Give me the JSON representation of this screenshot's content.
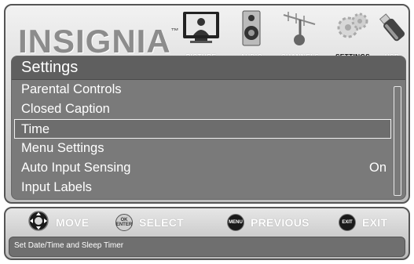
{
  "brand": {
    "logo_text": "INSIGNIA",
    "trademark": "™"
  },
  "tabs": [
    {
      "label": "PICTURE",
      "icon": "tv-icon",
      "active": false
    },
    {
      "label": "AUDIO",
      "icon": "speaker-icon",
      "active": false
    },
    {
      "label": "CHANNELS",
      "icon": "antenna-icon",
      "active": false
    },
    {
      "label": "SETTINGS",
      "icon": "gears-icon",
      "active": true
    },
    {
      "label": "USB",
      "icon": "usb-stick-icon",
      "active": false
    }
  ],
  "menu": {
    "title": "Settings",
    "items": [
      {
        "label": "Parental Controls",
        "value": ""
      },
      {
        "label": "Closed Caption",
        "value": ""
      },
      {
        "label": "Time",
        "value": "",
        "selected": true
      },
      {
        "label": "Menu Settings",
        "value": ""
      },
      {
        "label": "Auto Input Sensing",
        "value": "On"
      },
      {
        "label": "Input Labels",
        "value": ""
      }
    ]
  },
  "controls": {
    "move_label": "MOVE",
    "select_label": "SELECT",
    "ok_button_text": "OK ENTER",
    "previous_label": "PREVIOUS",
    "menu_button_text": "MENU",
    "exit_label": "EXIT",
    "exit_button_text": "EXIT"
  },
  "status": {
    "help_text": "Set Date/Time and Sleep Timer"
  },
  "colors": {
    "panel": "#7a7a7a",
    "title_bar": "#5f5f5f",
    "frame_light": "#f2f2f2",
    "frame_dark": "#bdbdbd",
    "selected_border": "#f0f0f0"
  }
}
